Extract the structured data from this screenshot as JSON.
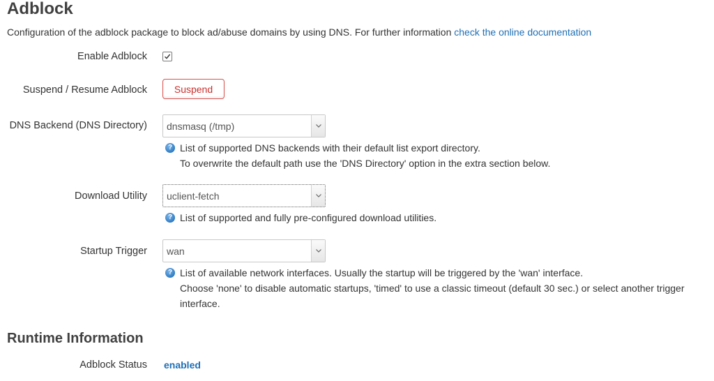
{
  "page": {
    "title": "Adblock",
    "description": "Configuration of the adblock package to block ad/abuse domains by using DNS. For further information ",
    "doc_link": "check the online documentation"
  },
  "fields": {
    "enable": {
      "label": "Enable Adblock",
      "checked": true
    },
    "suspend": {
      "label": "Suspend / Resume Adblock",
      "button": "Suspend"
    },
    "dns_backend": {
      "label": "DNS Backend (DNS Directory)",
      "value": "dnsmasq (/tmp)",
      "help": [
        "List of supported DNS backends with their default list export directory.",
        "To overwrite the default path use the 'DNS Directory' option in the extra section below."
      ]
    },
    "download_utility": {
      "label": "Download Utility",
      "value": "uclient-fetch",
      "help": [
        "List of supported and fully pre-configured download utilities."
      ]
    },
    "startup_trigger": {
      "label": "Startup Trigger",
      "value": "wan",
      "help": [
        "List of available network interfaces. Usually the startup will be triggered by the 'wan' interface.",
        "Choose 'none' to disable automatic startups, 'timed' to use a classic timeout (default 30 sec.) or select another trigger",
        "interface."
      ]
    }
  },
  "runtime": {
    "heading": "Runtime Information",
    "status_label": "Adblock Status",
    "status_value": "enabled"
  },
  "icons": {
    "help": "question-icon",
    "dropdown": "chevron-down-icon",
    "check": "checkmark-icon"
  },
  "colors": {
    "link": "#1f6fb5",
    "danger": "#d9534f",
    "heading": "#404040"
  }
}
